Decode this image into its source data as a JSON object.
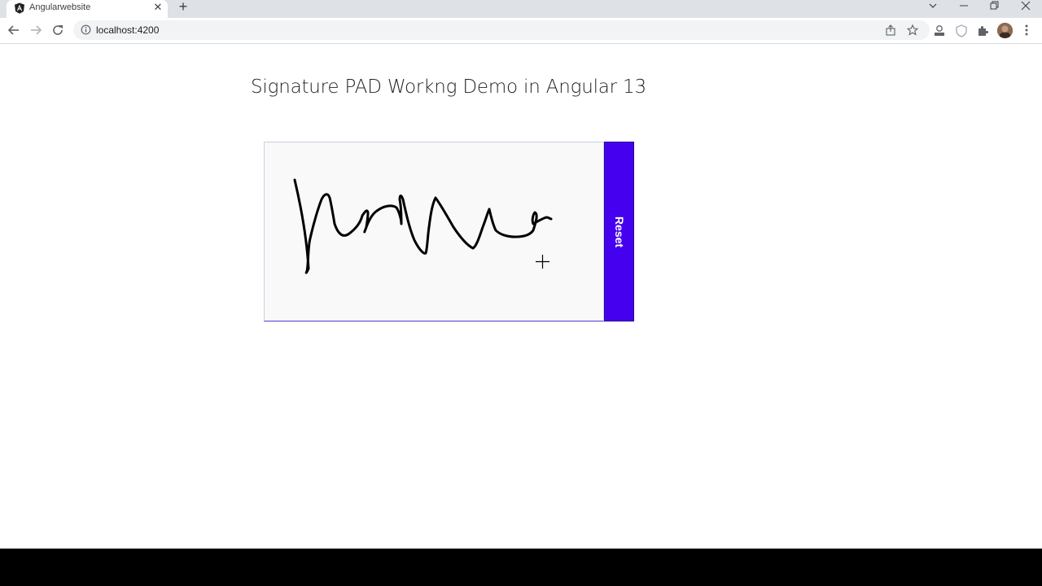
{
  "browser": {
    "tab": {
      "title": "Angularwebsite",
      "favicon": "angular-logo-icon",
      "close_glyph": "✕"
    },
    "new_tab_glyph": "+",
    "window_controls": {
      "tab_search_icon": "chevron-down-icon",
      "minimize_icon": "minimize-icon",
      "restore_icon": "restore-icon",
      "close_icon": "close-icon"
    },
    "address_bar": {
      "url": "localhost:4200",
      "site_info_icon": "info-icon"
    },
    "toolbar_icons": [
      "back-icon",
      "forward-icon",
      "reload-icon",
      "share-icon",
      "bookmark-star-icon",
      "download-extension-icon",
      "shield-extension-icon",
      "puzzle-extensions-icon",
      "profile-avatar",
      "menu-icon"
    ]
  },
  "page": {
    "title": "Signature PAD Workng Demo in Angular 13",
    "signature_pad": {
      "reset_label": "Reset",
      "canvas_background": "#f9f9f9",
      "button_color": "#4600f0",
      "stroke_color": "#000000"
    }
  },
  "colors": {
    "tabstrip": "#dee1e6",
    "omnibox": "#f1f3f4",
    "taskbar": "#000000"
  }
}
